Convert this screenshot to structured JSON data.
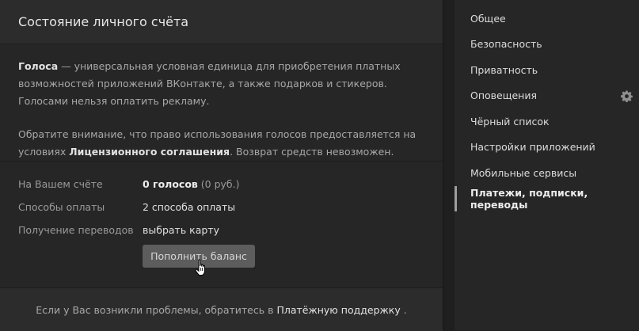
{
  "main": {
    "title": "Состояние личного счёта",
    "info_p1_bold": "Голоса",
    "info_p1_text": " — универсальная условная единица для приобретения платных возможностей приложений ВКонтакте, а также подарков и стикеров. Голосами нельзя оплатить рекламу.",
    "info_p2_pre": "Обратите внимание, что право использования голосов предоставляется на условиях ",
    "info_p2_link": "Лицензионного соглашения",
    "info_p2_post": ". Возврат средств невозможен.",
    "rows": [
      {
        "label": "На Вашем счёте",
        "value_bold": "0 голосов",
        "value_muted": " (0 руб.)"
      },
      {
        "label": "Способы оплаты",
        "value": "2 способа оплаты"
      },
      {
        "label": "Получение переводов",
        "value": "выбрать карту"
      }
    ],
    "topup_button": "Пополнить баланс",
    "footer_pre": "Если у Вас возникли проблемы, обратитесь в",
    "footer_link": "Платёжную поддержку",
    "footer_post": "."
  },
  "sidebar": {
    "items": [
      {
        "label": "Общее"
      },
      {
        "label": "Безопасность"
      },
      {
        "label": "Приватность"
      },
      {
        "label": "Оповещения"
      },
      {
        "label": "Чёрный список"
      },
      {
        "label": "Настройки приложений"
      },
      {
        "label": "Мобильные сервисы"
      },
      {
        "label": "Платежи, подписки, переводы"
      }
    ],
    "active_index": 7
  },
  "icons": {
    "settings": "gear-icon",
    "cursor": "hand-pointer-icon"
  },
  "colors": {
    "background": "#1f1f1f",
    "panel": "#262626",
    "header": "#2c2c2c",
    "button": "#5d5d5d"
  }
}
